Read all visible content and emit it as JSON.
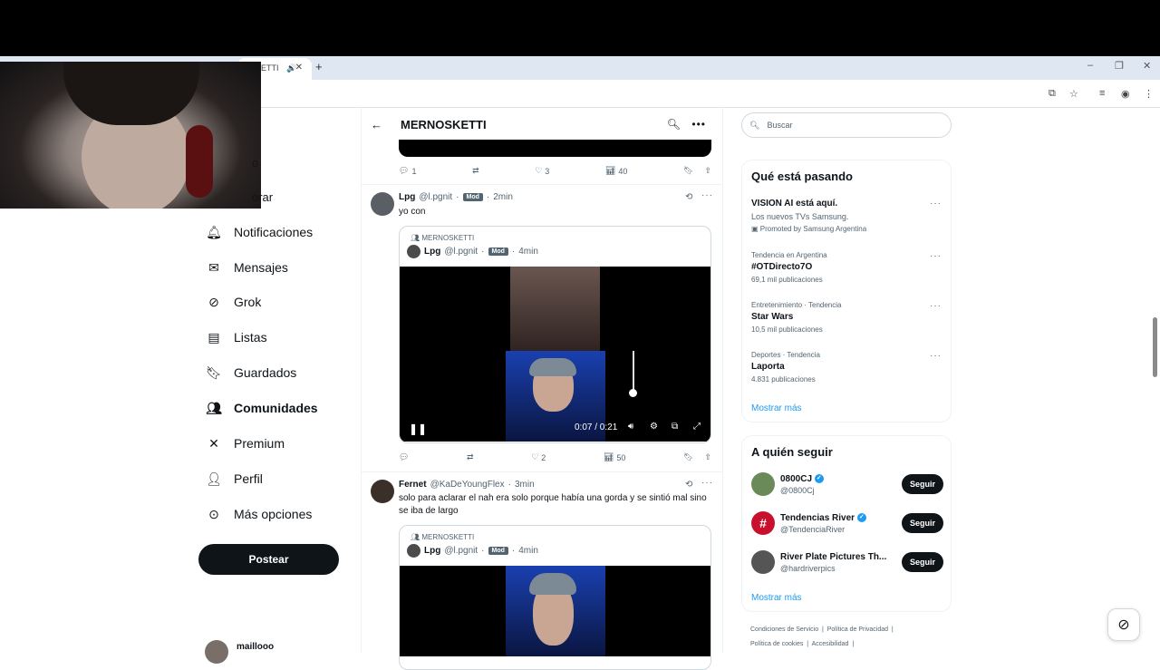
{
  "browser": {
    "tab_title": "ETTI",
    "new_tab": "+",
    "win_min": "–",
    "win_max": "❐",
    "win_close": "✕"
  },
  "sidebar": {
    "partial_items": [
      "o",
      "orar"
    ],
    "items": [
      {
        "icon": "bell-icon",
        "glyph": "🔔",
        "label": "Notificaciones"
      },
      {
        "icon": "envelope-icon",
        "glyph": "✉",
        "label": "Mensajes"
      },
      {
        "icon": "grok-icon",
        "glyph": "⊘",
        "label": "Grok"
      },
      {
        "icon": "list-icon",
        "glyph": "☰",
        "label": "Listas"
      },
      {
        "icon": "bookmark-icon",
        "glyph": "⚑",
        "label": "Guardados"
      },
      {
        "icon": "communities-icon",
        "glyph": "👥",
        "label": "Comunidades"
      },
      {
        "icon": "x-logo-icon",
        "glyph": "𝕏",
        "label": "Premium"
      },
      {
        "icon": "person-icon",
        "glyph": "👤",
        "label": "Perfil"
      },
      {
        "icon": "more-circle-icon",
        "glyph": "⊙",
        "label": "Más opciones"
      }
    ],
    "post_button": "Postear",
    "account_name": "maillooo"
  },
  "header": {
    "title": "MERNOSKETTI"
  },
  "post_prev_actions": {
    "replies": "1",
    "retweets": "",
    "likes": "3",
    "views": "40"
  },
  "tweet1": {
    "name": "Lpg",
    "handle": "@l.pgnit",
    "badge": "Mod",
    "time": "2min",
    "text": "yo con",
    "quote": {
      "community": "MERNOSKETTI",
      "name": "Lpg",
      "handle": "@l.pgnit",
      "badge": "Mod",
      "time": "4min"
    },
    "video_time": "0:07 / 0:21",
    "video_progress": 0.33,
    "actions": {
      "replies": "",
      "retweets": "",
      "likes": "2",
      "views": "50"
    }
  },
  "tweet2": {
    "name": "Fernet",
    "handle": "@KaDeYoungFlex",
    "time": "3min",
    "text": "solo para aclarar el nah era solo porque había una gorda y se sintió mal sino se iba de largo",
    "quote": {
      "community": "MERNOSKETTI",
      "name": "Lpg",
      "handle": "@l.pgnit",
      "badge": "Mod",
      "time": "4min"
    }
  },
  "right": {
    "search_placeholder": "Buscar",
    "trends_title": "Qué está pasando",
    "trends": [
      {
        "context": "",
        "name": "VISION AI está aquí.",
        "sub": "Los nuevos TVs Samsung.",
        "extra": "Promoted by Samsung Argentina"
      },
      {
        "context": "Tendencia en Argentina",
        "name": "#OTDirecto7O",
        "sub": "69,1 mil publicaciones",
        "extra": ""
      },
      {
        "context": "Entretenimiento · Tendencia",
        "name": "Star Wars",
        "sub": "10,5 mil publicaciones",
        "extra": ""
      },
      {
        "context": "Deportes · Tendencia",
        "name": "Laporta",
        "sub": "4.831 publicaciones",
        "extra": ""
      }
    ],
    "show_more": "Mostrar más",
    "follow_title": "A quién seguir",
    "follow": [
      {
        "name": "0800CJ",
        "handle": "@0800Cj",
        "verified": true,
        "button": "Seguir",
        "color": "#6b8a5a"
      },
      {
        "name": "Tendencias River",
        "handle": "@TendenciaRiver",
        "verified": true,
        "button": "Seguir",
        "color": "#c8102e"
      },
      {
        "name": "River Plate Pictures Th...",
        "handle": "@hardriverpics",
        "verified": false,
        "button": "Seguir",
        "color": "#555"
      }
    ],
    "follow_show_more": "Mostrar más",
    "footer": [
      "Condiciones de Servicio",
      "Política de Privacidad",
      "Política de cookies",
      "Accesibilidad"
    ]
  }
}
